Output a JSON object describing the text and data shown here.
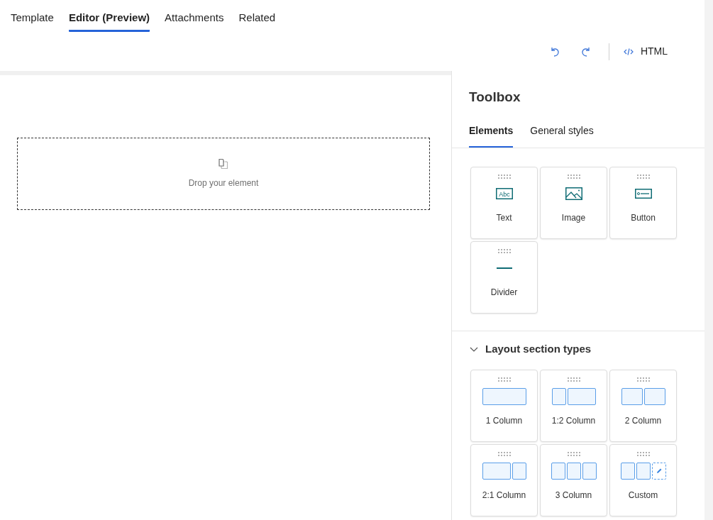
{
  "tabs": [
    {
      "label": "Template",
      "selected": false
    },
    {
      "label": "Editor (Preview)",
      "selected": true
    },
    {
      "label": "Attachments",
      "selected": false
    },
    {
      "label": "Related",
      "selected": false
    }
  ],
  "toolbar": {
    "html_button": "HTML"
  },
  "canvas": {
    "drop_zone": "Drop your element"
  },
  "toolbox": {
    "title": "Toolbox",
    "tabs": [
      {
        "label": "Elements",
        "selected": true
      },
      {
        "label": "General styles",
        "selected": false
      }
    ],
    "elements": [
      {
        "kind": "text",
        "label": "Text",
        "icon_text": "Abc"
      },
      {
        "kind": "image",
        "label": "Image"
      },
      {
        "kind": "button",
        "label": "Button"
      },
      {
        "kind": "divider",
        "label": "Divider"
      }
    ],
    "layout_section": {
      "title": "Layout section types",
      "expanded": true,
      "items": [
        {
          "kind": "one",
          "label": "1 Column"
        },
        {
          "kind": "one-two",
          "label": "1:2 Column"
        },
        {
          "kind": "two",
          "label": "2 Column"
        },
        {
          "kind": "two-one",
          "label": "2:1 Column"
        },
        {
          "kind": "three",
          "label": "3 Column"
        },
        {
          "kind": "custom",
          "label": "Custom"
        }
      ]
    }
  }
}
